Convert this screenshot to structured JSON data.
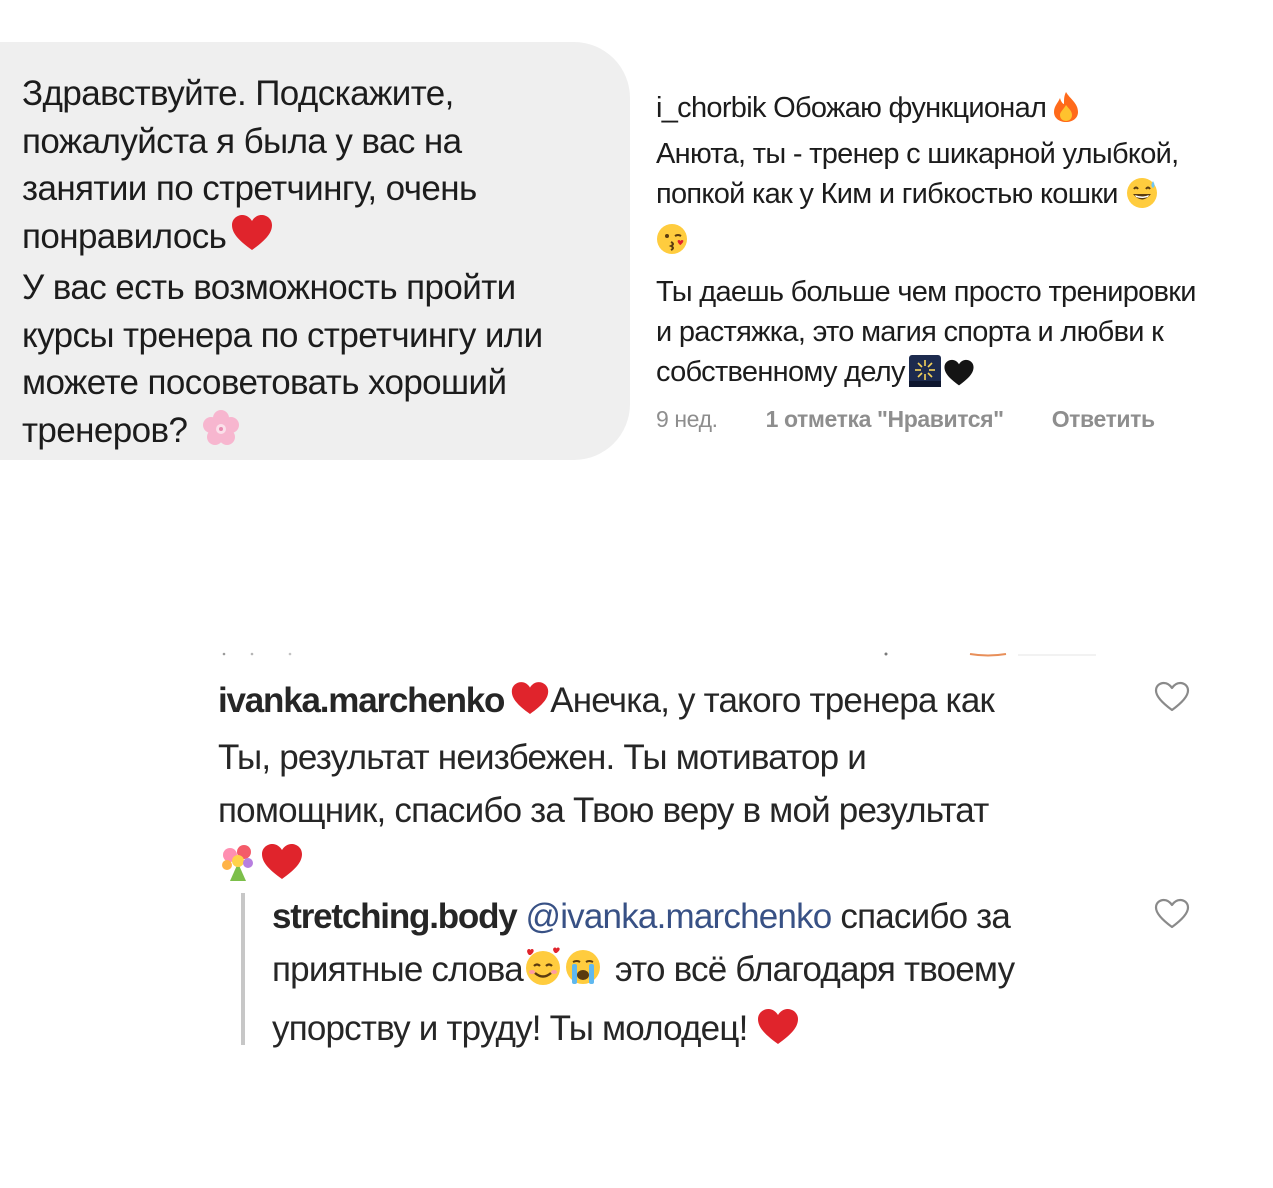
{
  "message": {
    "lines": [
      "Здравствуйте. Подскажите,",
      "пожалуйста я была у вас на",
      "занятии по стретчингу, очень",
      "понравилось",
      "У вас есть возможность пройти",
      "курсы тренера по стретчингу или",
      "можете посоветовать хороший",
      "тренеров?"
    ]
  },
  "comment_top": {
    "username": "i_chorbik",
    "line1_text": "Обожаю функционал",
    "line2": "Анюта, ты - тренер с шикарной улыбкой,",
    "line3": "попкой как у Ким и гибкостью кошки",
    "line4": "Ты даешь больше чем просто тренировки",
    "line5": "и растяжка, это магия спорта и любви к",
    "line6": "собственному делу",
    "time": "9 нед.",
    "likes": "1 отметка \"Нравится\"",
    "reply": "Ответить"
  },
  "comment_bottom": {
    "username": "ivanka.marchenko",
    "line1_text": "Анечка, у такого тренера как",
    "line2": "Ты, результат неизбежен. Ты мотиватор и",
    "line3": "помощник, спасибо за Твою веру в мой результат"
  },
  "reply_comment": {
    "username": "stretching.body",
    "mention": "@ivanka.marchenko",
    "line1_text": "спасибо за",
    "line2_a": "приятные слова",
    "line2_b": "это всё благодаря твоему",
    "line3": "упорству и труду! Ты молодец!"
  },
  "colors": {
    "bubble_bg": "#efefef",
    "heart_red": "#e0242c",
    "mention_blue": "#385185",
    "meta_gray": "#8e8e8e"
  }
}
